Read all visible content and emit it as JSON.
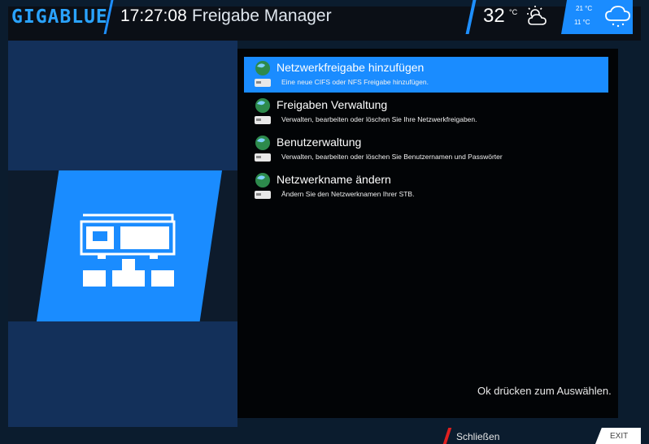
{
  "header": {
    "logo": "GIGABLUE",
    "time": "17:27:08",
    "title": "Freigabe Manager",
    "temperature": "32",
    "temperature_unit": "°C",
    "weather_icon": "partly-cloudy-icon",
    "forecast_high": "21 °C",
    "forecast_low": "11 °C",
    "forecast_icon": "rain-cloud-icon"
  },
  "menu": {
    "items": [
      {
        "title": "Netzwerkfreigabe hinzufügen",
        "description": "Eine neue CIFS oder NFS Freigabe hinzufügen.",
        "selected": true,
        "icon": "network-drive-icon"
      },
      {
        "title": "Freigaben Verwaltung",
        "description": "Verwalten, bearbeiten oder löschen Sie Ihre Netzwerkfreigaben.",
        "selected": false,
        "icon": "network-drive-icon"
      },
      {
        "title": "Benutzerwaltung",
        "description": "Verwalten, bearbeiten oder löschen Sie Benutzernamen und Passwörter",
        "selected": false,
        "icon": "network-drive-icon"
      },
      {
        "title": "Netzwerkname ändern",
        "description": "Ändern Sie den Netzwerknamen Ihrer STB.",
        "selected": false,
        "icon": "network-drive-icon"
      }
    ],
    "hint": "Ok drücken zum Auswählen."
  },
  "footer": {
    "close_label": "Schließen",
    "exit_label": "EXIT"
  },
  "colors": {
    "accent": "#1a8cff",
    "background": "#0b1c2e",
    "panel": "#020406",
    "red_key": "#e02020"
  }
}
